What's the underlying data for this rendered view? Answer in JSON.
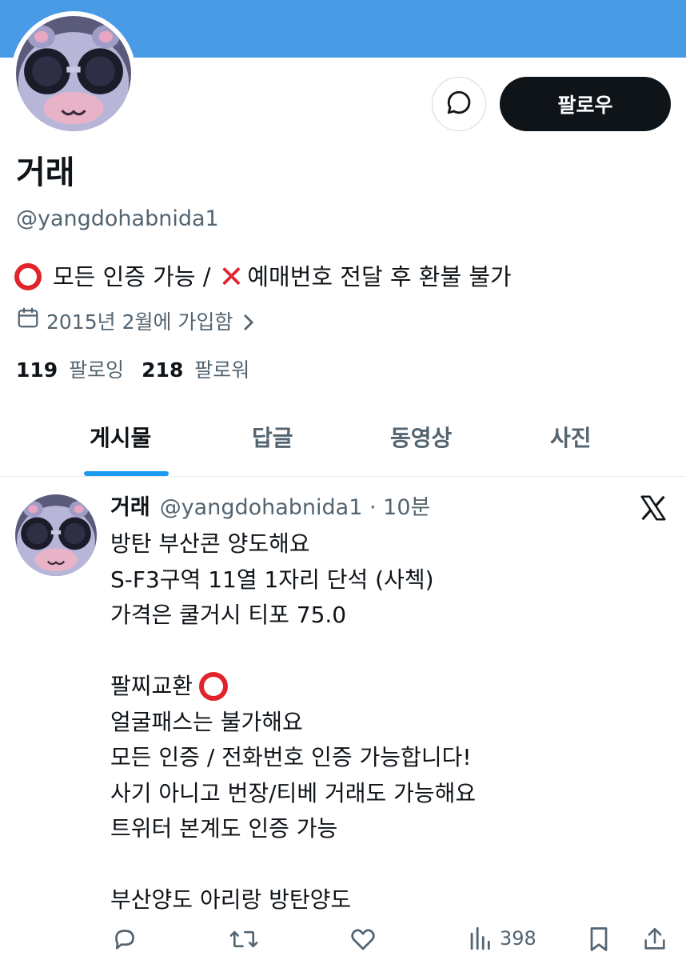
{
  "profile": {
    "display_name": "거래",
    "handle": "@yangdohabnida1",
    "follow_label": "팔로우",
    "bio": {
      "part1": "모든 인증 가능 / ",
      "part2": "예매번호 전달 후 환불 불가"
    },
    "joined": "2015년 2월에 가입함",
    "following_count": "119",
    "following_label": "팔로잉",
    "followers_count": "218",
    "followers_label": "팔로워"
  },
  "tabs": [
    {
      "label": "게시물",
      "active": true
    },
    {
      "label": "답글",
      "active": false
    },
    {
      "label": "동영상",
      "active": false
    },
    {
      "label": "사진",
      "active": false
    }
  ],
  "tweet": {
    "name": "거래",
    "handle_time": "@yangdohabnida1 · 10분",
    "lines": [
      "방탄 부산콘 양도해요",
      "S-F3구역 11열 1자리 단석 (사첵)",
      "가격은 쿨거시 티포 75.0",
      "",
      "팔찌교환 ",
      "얼굴패스는 불가해요",
      "모든 인증 / 전화번호 인증 가능합니다!",
      "사기 아니고 번장/티베 거래도 가능해요",
      "트위터 본계도 인증 가능",
      "",
      "부산양도 아리랑 방탄양도"
    ],
    "views": "398"
  },
  "icons": {
    "message": "message-icon",
    "calendar": "calendar-icon",
    "chevron": "chevron-right-icon",
    "x_logo": "x-logo-icon",
    "reply": "reply-icon",
    "retweet": "retweet-icon",
    "like": "like-icon",
    "views": "views-icon",
    "bookmark": "bookmark-icon",
    "share": "share-icon",
    "circle_emoji": "red-circle-icon",
    "cross_emoji": "red-cross-icon"
  },
  "colors": {
    "banner": "#4a9be6",
    "accent": "#1d9bf0",
    "text": "#0f1419",
    "muted": "#536471",
    "emoji_red": "#e0242c"
  }
}
